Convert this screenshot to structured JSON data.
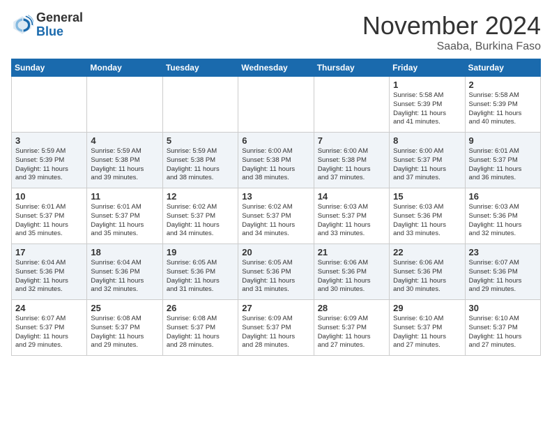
{
  "logo": {
    "general": "General",
    "blue": "Blue"
  },
  "header": {
    "month": "November 2024",
    "location": "Saaba, Burkina Faso"
  },
  "weekdays": [
    "Sunday",
    "Monday",
    "Tuesday",
    "Wednesday",
    "Thursday",
    "Friday",
    "Saturday"
  ],
  "weeks": [
    [
      {
        "day": "",
        "info": ""
      },
      {
        "day": "",
        "info": ""
      },
      {
        "day": "",
        "info": ""
      },
      {
        "day": "",
        "info": ""
      },
      {
        "day": "",
        "info": ""
      },
      {
        "day": "1",
        "info": "Sunrise: 5:58 AM\nSunset: 5:39 PM\nDaylight: 11 hours\nand 41 minutes."
      },
      {
        "day": "2",
        "info": "Sunrise: 5:58 AM\nSunset: 5:39 PM\nDaylight: 11 hours\nand 40 minutes."
      }
    ],
    [
      {
        "day": "3",
        "info": "Sunrise: 5:59 AM\nSunset: 5:39 PM\nDaylight: 11 hours\nand 39 minutes."
      },
      {
        "day": "4",
        "info": "Sunrise: 5:59 AM\nSunset: 5:38 PM\nDaylight: 11 hours\nand 39 minutes."
      },
      {
        "day": "5",
        "info": "Sunrise: 5:59 AM\nSunset: 5:38 PM\nDaylight: 11 hours\nand 38 minutes."
      },
      {
        "day": "6",
        "info": "Sunrise: 6:00 AM\nSunset: 5:38 PM\nDaylight: 11 hours\nand 38 minutes."
      },
      {
        "day": "7",
        "info": "Sunrise: 6:00 AM\nSunset: 5:38 PM\nDaylight: 11 hours\nand 37 minutes."
      },
      {
        "day": "8",
        "info": "Sunrise: 6:00 AM\nSunset: 5:37 PM\nDaylight: 11 hours\nand 37 minutes."
      },
      {
        "day": "9",
        "info": "Sunrise: 6:01 AM\nSunset: 5:37 PM\nDaylight: 11 hours\nand 36 minutes."
      }
    ],
    [
      {
        "day": "10",
        "info": "Sunrise: 6:01 AM\nSunset: 5:37 PM\nDaylight: 11 hours\nand 35 minutes."
      },
      {
        "day": "11",
        "info": "Sunrise: 6:01 AM\nSunset: 5:37 PM\nDaylight: 11 hours\nand 35 minutes."
      },
      {
        "day": "12",
        "info": "Sunrise: 6:02 AM\nSunset: 5:37 PM\nDaylight: 11 hours\nand 34 minutes."
      },
      {
        "day": "13",
        "info": "Sunrise: 6:02 AM\nSunset: 5:37 PM\nDaylight: 11 hours\nand 34 minutes."
      },
      {
        "day": "14",
        "info": "Sunrise: 6:03 AM\nSunset: 5:37 PM\nDaylight: 11 hours\nand 33 minutes."
      },
      {
        "day": "15",
        "info": "Sunrise: 6:03 AM\nSunset: 5:36 PM\nDaylight: 11 hours\nand 33 minutes."
      },
      {
        "day": "16",
        "info": "Sunrise: 6:03 AM\nSunset: 5:36 PM\nDaylight: 11 hours\nand 32 minutes."
      }
    ],
    [
      {
        "day": "17",
        "info": "Sunrise: 6:04 AM\nSunset: 5:36 PM\nDaylight: 11 hours\nand 32 minutes."
      },
      {
        "day": "18",
        "info": "Sunrise: 6:04 AM\nSunset: 5:36 PM\nDaylight: 11 hours\nand 32 minutes."
      },
      {
        "day": "19",
        "info": "Sunrise: 6:05 AM\nSunset: 5:36 PM\nDaylight: 11 hours\nand 31 minutes."
      },
      {
        "day": "20",
        "info": "Sunrise: 6:05 AM\nSunset: 5:36 PM\nDaylight: 11 hours\nand 31 minutes."
      },
      {
        "day": "21",
        "info": "Sunrise: 6:06 AM\nSunset: 5:36 PM\nDaylight: 11 hours\nand 30 minutes."
      },
      {
        "day": "22",
        "info": "Sunrise: 6:06 AM\nSunset: 5:36 PM\nDaylight: 11 hours\nand 30 minutes."
      },
      {
        "day": "23",
        "info": "Sunrise: 6:07 AM\nSunset: 5:36 PM\nDaylight: 11 hours\nand 29 minutes."
      }
    ],
    [
      {
        "day": "24",
        "info": "Sunrise: 6:07 AM\nSunset: 5:37 PM\nDaylight: 11 hours\nand 29 minutes."
      },
      {
        "day": "25",
        "info": "Sunrise: 6:08 AM\nSunset: 5:37 PM\nDaylight: 11 hours\nand 29 minutes."
      },
      {
        "day": "26",
        "info": "Sunrise: 6:08 AM\nSunset: 5:37 PM\nDaylight: 11 hours\nand 28 minutes."
      },
      {
        "day": "27",
        "info": "Sunrise: 6:09 AM\nSunset: 5:37 PM\nDaylight: 11 hours\nand 28 minutes."
      },
      {
        "day": "28",
        "info": "Sunrise: 6:09 AM\nSunset: 5:37 PM\nDaylight: 11 hours\nand 27 minutes."
      },
      {
        "day": "29",
        "info": "Sunrise: 6:10 AM\nSunset: 5:37 PM\nDaylight: 11 hours\nand 27 minutes."
      },
      {
        "day": "30",
        "info": "Sunrise: 6:10 AM\nSunset: 5:37 PM\nDaylight: 11 hours\nand 27 minutes."
      }
    ]
  ]
}
